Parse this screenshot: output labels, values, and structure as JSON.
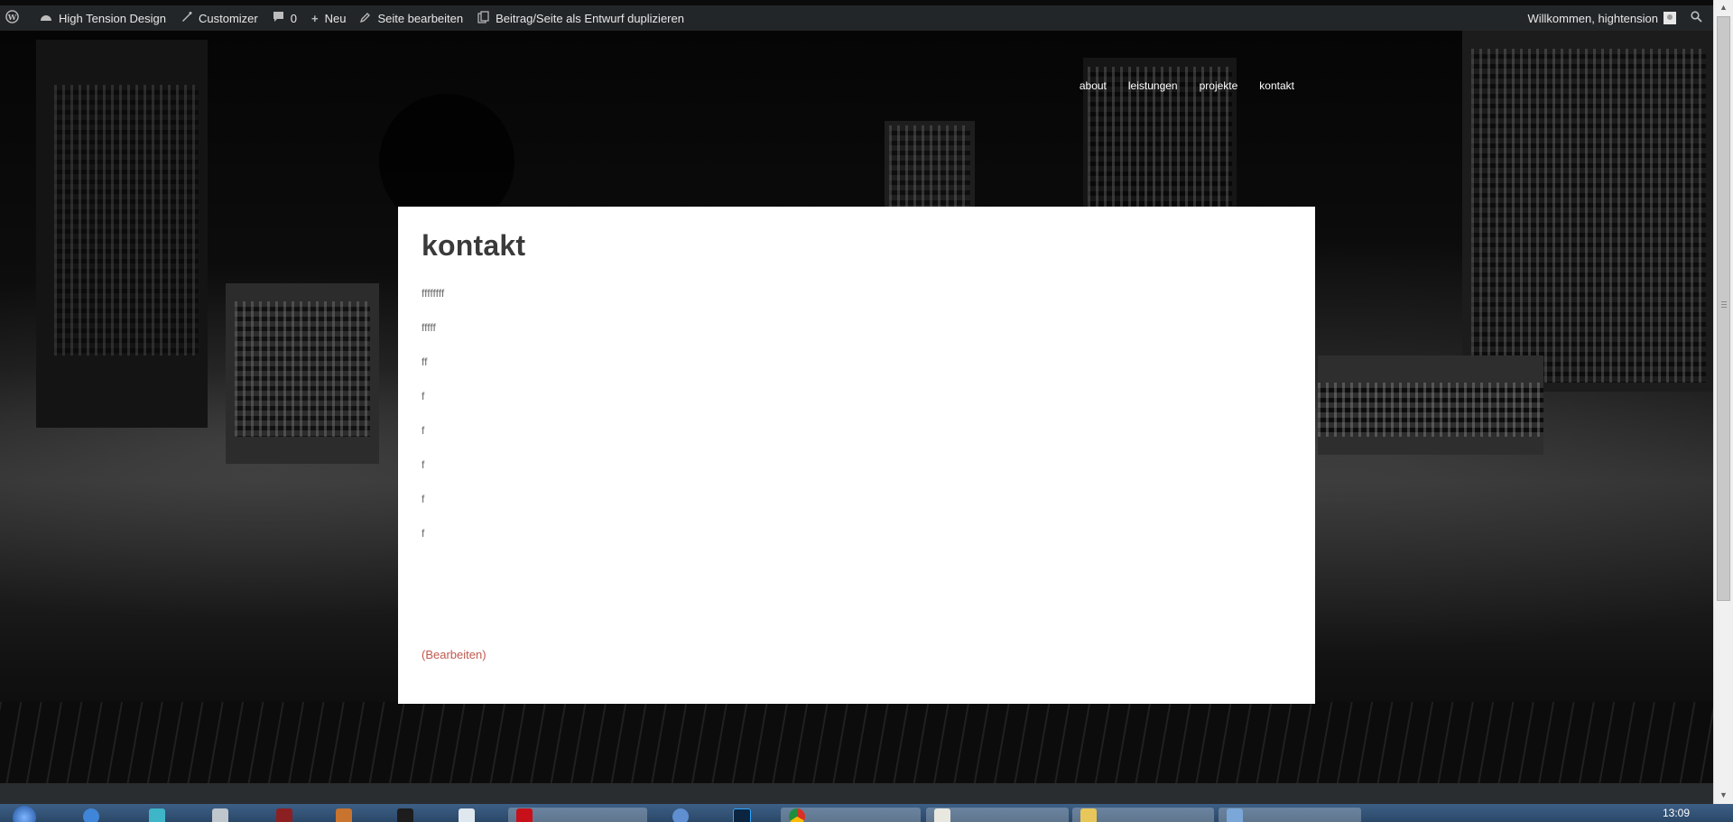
{
  "adminbar": {
    "site_name": "High Tension Design",
    "customizer": "Customizer",
    "comments_count": "0",
    "new_label": "Neu",
    "edit_page": "Seite bearbeiten",
    "duplicate": "Beitrag/Seite als Entwurf duplizieren",
    "welcome": "Willkommen, hightension"
  },
  "nav": {
    "items": [
      "about",
      "leistungen",
      "projekte",
      "kontakt"
    ]
  },
  "page": {
    "title": "kontakt",
    "paragraphs": [
      "ffffffff",
      "fffff",
      "ff",
      "f",
      "f",
      "f",
      "f",
      "f"
    ],
    "edit_link": "(Bearbeiten)"
  },
  "taskbar": {
    "clock": "13:09"
  },
  "colors": {
    "adminbar_bg": "#232628",
    "edit_link": "#c0594f",
    "title": "#3a3a3a"
  }
}
